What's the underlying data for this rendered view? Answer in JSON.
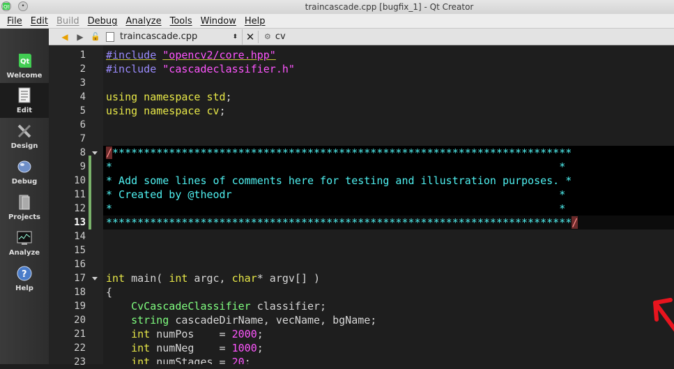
{
  "window": {
    "title": "traincascade.cpp [bugfix_1] - Qt Creator"
  },
  "menu": [
    "File",
    "Edit",
    "Build",
    "Debug",
    "Analyze",
    "Tools",
    "Window",
    "Help"
  ],
  "toolbar": {
    "file_name": "traincascade.cpp",
    "symbol": "cv"
  },
  "modes": [
    {
      "label": "Welcome",
      "icon": "qt-logo-icon"
    },
    {
      "label": "Edit",
      "icon": "document-edit-icon"
    },
    {
      "label": "Design",
      "icon": "design-tools-icon"
    },
    {
      "label": "Debug",
      "icon": "debug-bug-icon"
    },
    {
      "label": "Projects",
      "icon": "projects-icon"
    },
    {
      "label": "Analyze",
      "icon": "analyze-monitor-icon"
    },
    {
      "label": "Help",
      "icon": "help-icon"
    }
  ],
  "editor": {
    "current_line": 13,
    "line_numbers": [
      "1",
      "2",
      "3",
      "4",
      "5",
      "6",
      "7",
      "8",
      "9",
      "10",
      "11",
      "12",
      "13",
      "14",
      "15",
      "16",
      "17",
      "18",
      "19",
      "20",
      "21",
      "22",
      "23"
    ],
    "code": {
      "l1_pp": "#include",
      "l1_str": "\"opencv2/core.hpp\"",
      "l2_pp": "#include",
      "l2_str": "\"cascadeclassifier.h\"",
      "l4_kw": "using namespace",
      "l4_ns": "std",
      "l4_end": ";",
      "l5_kw": "using namespace",
      "l5_ns": "cv",
      "l5_end": ";",
      "l8_slash": "/",
      "l8_stars": "*************************************************************************",
      "l9": "*                                                                       *",
      "l10": "* Add some lines of comments here for testing and illustration purposes. *",
      "l11": "* Created by @theodr                                                    *",
      "l12": "*                                                                       *",
      "l13_stars": "**************************************************************************",
      "l13_slash": "/",
      "l17_int1": "int",
      "l17_a": " main( ",
      "l17_int2": "int",
      "l17_b": " argc, ",
      "l17_char": "char",
      "l17_c": "* argv[] )",
      "l18": "{",
      "l19_type": "CvCascadeClassifier",
      "l19_rest": " classifier;",
      "l20_type": "string",
      "l20_rest": " cascadeDirName, vecName, bgName;",
      "l21_int": "int",
      "l21_mid": " numPos    = ",
      "l21_num": "2000",
      "l21_end": ";",
      "l22_int": "int",
      "l22_mid": " numNeg    = ",
      "l22_num": "1000",
      "l22_end": ";",
      "l23_int": "int",
      "l23_mid": " numStages = ",
      "l23_num": "20",
      "l23_end": ";"
    }
  },
  "colors": {
    "editor_bg": "#1e1e1e",
    "comment": "#4ff0f0",
    "keyword": "#e8e848",
    "string": "#ff56ff",
    "preprocessor": "#9b8cff",
    "type": "#80ff80",
    "arrow": "#e8141e"
  }
}
